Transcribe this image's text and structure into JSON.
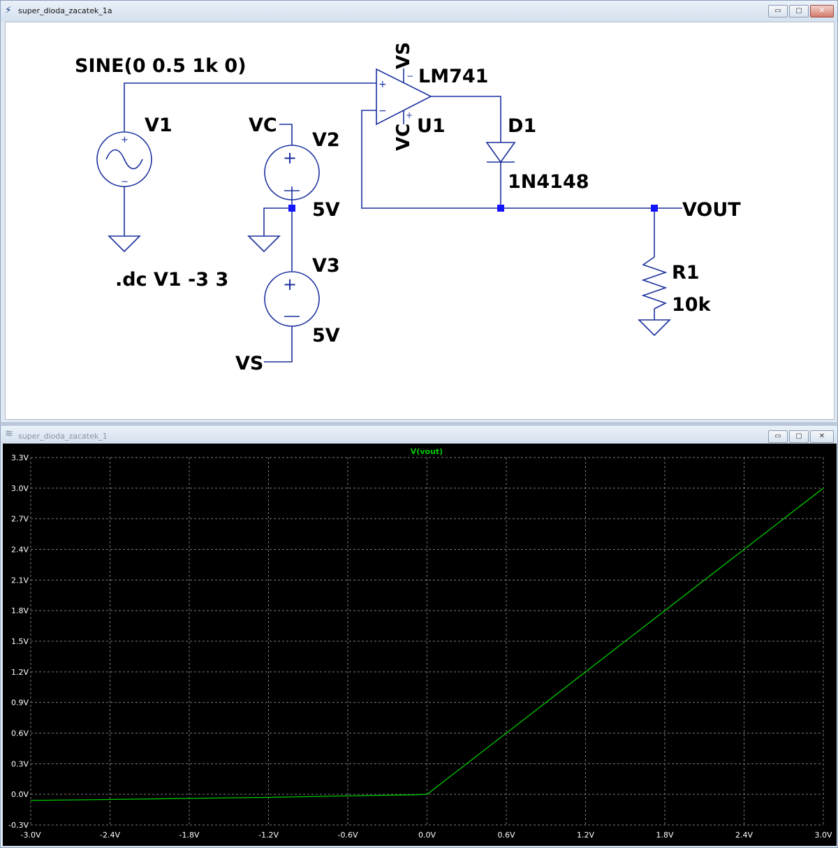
{
  "schematic_window": {
    "title": "super_dioda_zacatek_1a",
    "icon": "schematic-icon",
    "buttons": {
      "minimize": "▭",
      "maximize": "▢",
      "close": "✕"
    }
  },
  "schematic": {
    "source_spec": "SINE(0 0.5 1k 0)",
    "v1_label": "V1",
    "v2_label": "V2",
    "v2_value": "5V",
    "v3_label": "V3",
    "v3_value": "5V",
    "vc_net": "VC",
    "vs_net": "VS",
    "opamp_model": "LM741",
    "opamp_name": "U1",
    "opamp_vs": "VS",
    "opamp_vc": "VC",
    "diode_name": "D1",
    "diode_model": "1N4148",
    "out_net": "VOUT",
    "r1_name": "R1",
    "r1_value": "10k",
    "directive": ".dc V1 -3 3",
    "wire_color": "#1a2f9e",
    "junction_color": "#1414ff"
  },
  "plot_window": {
    "title": "super_dioda_zacatek_1",
    "icon": "waveform-icon",
    "buttons": {
      "minimize": "▭",
      "maximize": "▢",
      "close": "✕"
    }
  },
  "chart_data": {
    "type": "line",
    "title": "V(vout)",
    "x_ticks": [
      "-3.0V",
      "-2.4V",
      "-1.8V",
      "-1.2V",
      "-0.6V",
      "0.0V",
      "0.6V",
      "1.2V",
      "1.8V",
      "2.4V",
      "3.0V"
    ],
    "y_ticks": [
      "3.3V",
      "3.0V",
      "2.7V",
      "2.4V",
      "2.1V",
      "1.8V",
      "1.5V",
      "1.2V",
      "0.9V",
      "0.6V",
      "0.3V",
      "0.0V",
      "-0.3V"
    ],
    "xlim": [
      -3.0,
      3.0
    ],
    "ylim": [
      -0.3,
      3.3
    ],
    "grid": true,
    "background": "#000000",
    "trace_color": "#00c800",
    "series": [
      {
        "name": "V(vout)",
        "x": [
          -3.0,
          -2.4,
          -1.8,
          -1.2,
          -0.6,
          -0.1,
          0.0,
          0.6,
          1.2,
          1.8,
          2.4,
          3.0
        ],
        "y": [
          -0.06,
          -0.05,
          -0.04,
          -0.03,
          -0.015,
          -0.004,
          0.0,
          0.6,
          1.2,
          1.8,
          2.4,
          3.0
        ]
      }
    ]
  }
}
